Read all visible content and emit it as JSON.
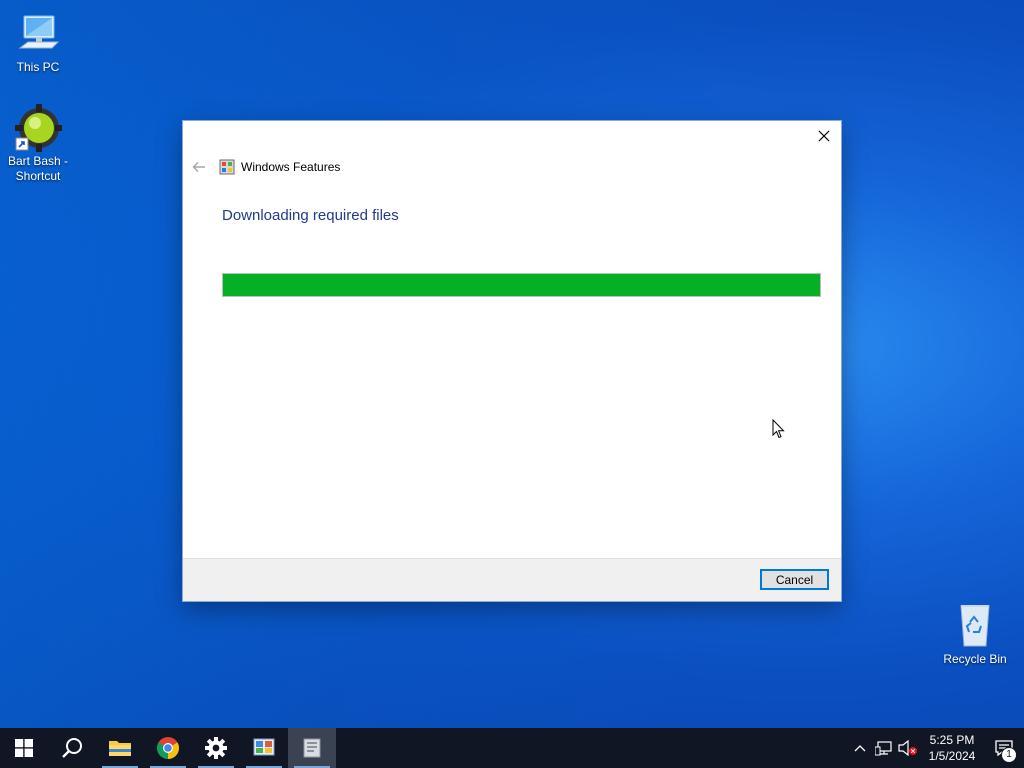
{
  "desktop": {
    "icons": [
      {
        "label": "This PC",
        "icon": "computer-icon"
      },
      {
        "label": "Bart Bash - Shortcut",
        "icon": "bart-bash-shortcut-icon"
      },
      {
        "label": "Recycle Bin",
        "icon": "recycle-bin-icon"
      }
    ]
  },
  "dialog": {
    "title": "Windows Features",
    "heading": "Downloading required files",
    "progress_percent": 100,
    "cancel_label": "Cancel",
    "close_icon": "close-icon",
    "back_icon": "back-arrow-icon",
    "title_icon": "windows-features-icon",
    "accent_color": "#06b025"
  },
  "taskbar": {
    "items": [
      {
        "name": "start",
        "icon": "windows-start-icon"
      },
      {
        "name": "search",
        "icon": "search-icon"
      },
      {
        "name": "file-explorer",
        "icon": "folder-icon"
      },
      {
        "name": "chrome",
        "icon": "chrome-icon"
      },
      {
        "name": "settings",
        "icon": "gear-icon"
      },
      {
        "name": "control-panel",
        "icon": "control-panel-icon"
      },
      {
        "name": "windows-features",
        "icon": "windows-features-icon"
      }
    ],
    "tray": {
      "time": "5:25 PM",
      "date": "1/5/2024",
      "notification_count": "1"
    }
  }
}
